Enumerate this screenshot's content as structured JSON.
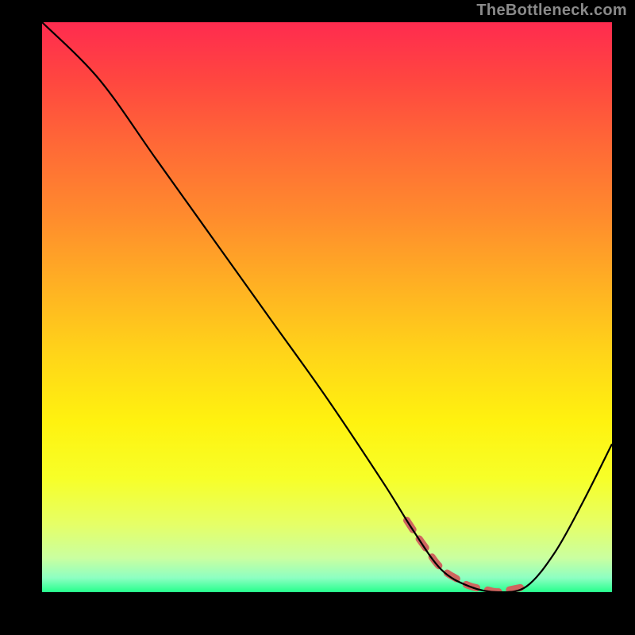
{
  "watermark": "TheBottleneck.com",
  "chart_data": {
    "type": "line",
    "title": "",
    "xlabel": "",
    "ylabel": "",
    "xlim": [
      0,
      100
    ],
    "ylim": [
      0,
      100
    ],
    "series": [
      {
        "name": "curve",
        "x": [
          0,
          10,
          20,
          30,
          40,
          50,
          60,
          65,
          70,
          75,
          80,
          85,
          90,
          95,
          100
        ],
        "y": [
          100,
          90,
          76,
          62,
          48,
          34,
          19,
          11,
          4,
          1,
          0,
          1,
          7,
          16,
          26
        ]
      }
    ],
    "highlight_range": {
      "x_start": 64,
      "x_end": 85
    },
    "grid": false,
    "legend": false,
    "background_gradient": {
      "stops": [
        {
          "pos": 0.0,
          "color": "#ff2b4f"
        },
        {
          "pos": 0.6,
          "color": "#ffe014"
        },
        {
          "pos": 1.0,
          "color": "#26ff8c"
        }
      ]
    }
  },
  "colors": {
    "curve": "#000000",
    "highlight": "#cf655f",
    "frame": "#000000"
  }
}
